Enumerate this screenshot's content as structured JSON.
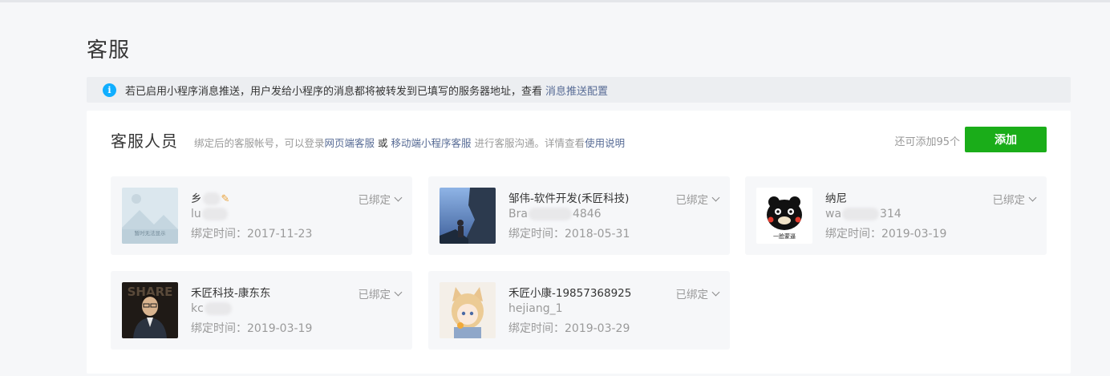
{
  "page": {
    "title": "客服"
  },
  "notice": {
    "icon": "info-icon",
    "text": "若已启用小程序消息推送，用户发给小程序的消息都将被转发到已填写的服务器地址，查看",
    "link": "消息推送配置"
  },
  "panel": {
    "title": "客服人员",
    "desc_prefix": "绑定后的客服帐号，可以登录",
    "link_web": "网页端客服",
    "or": "或",
    "link_mobile": "移动端小程序客服",
    "desc_middle": "进行客服沟通。详情查看",
    "link_help": "使用说明",
    "quota": "还可添加95个",
    "add_label": "添加"
  },
  "colors": {
    "accent": "#1aad19",
    "link": "#576b95",
    "info": "#10aeff"
  },
  "agents": [
    {
      "name_visible": "乡",
      "name_suffix_icon": "pencil-icon",
      "account_visible": "lu",
      "account_suffix": "",
      "time": "绑定时间：2017-11-23",
      "status": "已绑定",
      "avatar": "placeholder-avatar",
      "avatar_text": "暂时无法显示"
    },
    {
      "name_visible": "邹伟-软件开发(禾匠科技)",
      "account_visible": "Bra",
      "account_suffix": "4846",
      "time": "绑定时间：2018-05-31",
      "status": "已绑定",
      "avatar": "landscape-avatar"
    },
    {
      "name_visible": "纳尼",
      "account_visible": "wa",
      "account_suffix": "314",
      "time": "绑定时间：2019-03-19",
      "status": "已绑定",
      "avatar": "bear-avatar",
      "avatar_text": "一脸蒙逼"
    },
    {
      "name_visible": "禾匠科技-康东东",
      "account_visible": "kc",
      "account_suffix": "",
      "time": "绑定时间：2019-03-19",
      "status": "已绑定",
      "avatar": "portrait-avatar",
      "avatar_text": "SHARE"
    },
    {
      "name_visible": "禾匠小康-19857368925",
      "account_visible": "hejiang_1",
      "account_suffix": "",
      "time": "绑定时间：2019-03-29",
      "status": "已绑定",
      "avatar": "anime-avatar"
    }
  ]
}
